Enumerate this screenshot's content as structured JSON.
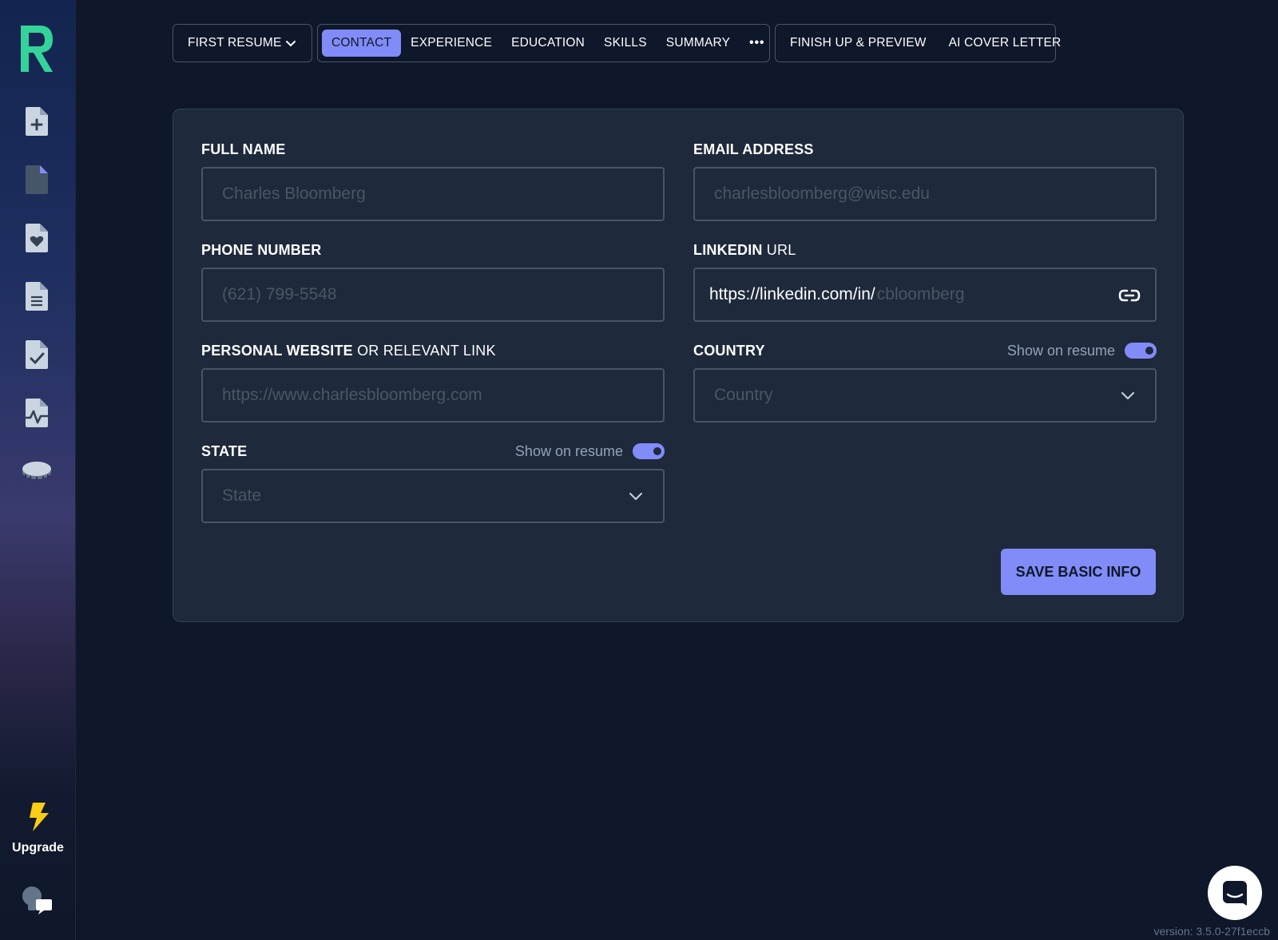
{
  "colors": {
    "background": "#0f172a",
    "card": "#1e293b",
    "accent": "#818cf8",
    "logo": "#34d399",
    "upgrade_bolt": "#facc15"
  },
  "sidebar": {
    "logo_icon": "resume-logo-icon",
    "items": [
      {
        "icon": "new-document-icon"
      },
      {
        "icon": "document-icon"
      },
      {
        "icon": "favorite-document-icon"
      },
      {
        "icon": "text-document-icon"
      },
      {
        "icon": "checked-document-icon"
      },
      {
        "icon": "activity-document-icon"
      },
      {
        "icon": "coin-icon"
      }
    ],
    "upgrade_label": "Upgrade",
    "help_icon": "lightbulb-chat-icon"
  },
  "nav": {
    "resume_select": "FIRST RESUME",
    "tabs": [
      {
        "label": "CONTACT",
        "active": true
      },
      {
        "label": "EXPERIENCE",
        "active": false
      },
      {
        "label": "EDUCATION",
        "active": false
      },
      {
        "label": "SKILLS",
        "active": false
      },
      {
        "label": "SUMMARY",
        "active": false
      }
    ],
    "more_label": "•••",
    "secondary_tabs": [
      {
        "label": "FINISH UP & PREVIEW"
      },
      {
        "label": "AI COVER LETTER"
      }
    ]
  },
  "form": {
    "full_name": {
      "label": "FULL NAME",
      "placeholder": "Charles Bloomberg",
      "value": ""
    },
    "email": {
      "label": "EMAIL ADDRESS",
      "placeholder": "charlesbloomberg@wisc.edu",
      "value": ""
    },
    "phone": {
      "label": "PHONE NUMBER",
      "placeholder": "(621) 799-5548",
      "value": ""
    },
    "linkedin": {
      "label_bold": "LINKEDIN",
      "label_light": " URL",
      "prefix": "https://linkedin.com/in/",
      "placeholder": "cbloomberg",
      "value": ""
    },
    "website": {
      "label_bold": "PERSONAL WEBSITE",
      "label_light": " OR RELEVANT LINK",
      "placeholder": "https://www.charlesbloomberg.com",
      "value": ""
    },
    "country": {
      "label": "COUNTRY",
      "placeholder": "Country",
      "toggle_label": "Show on resume",
      "show_on_resume": true
    },
    "state": {
      "label": "STATE",
      "placeholder": "State",
      "toggle_label": "Show on resume",
      "show_on_resume": true
    },
    "save_label": "SAVE BASIC INFO"
  },
  "version": "version: 3.5.0-27f1eccb"
}
